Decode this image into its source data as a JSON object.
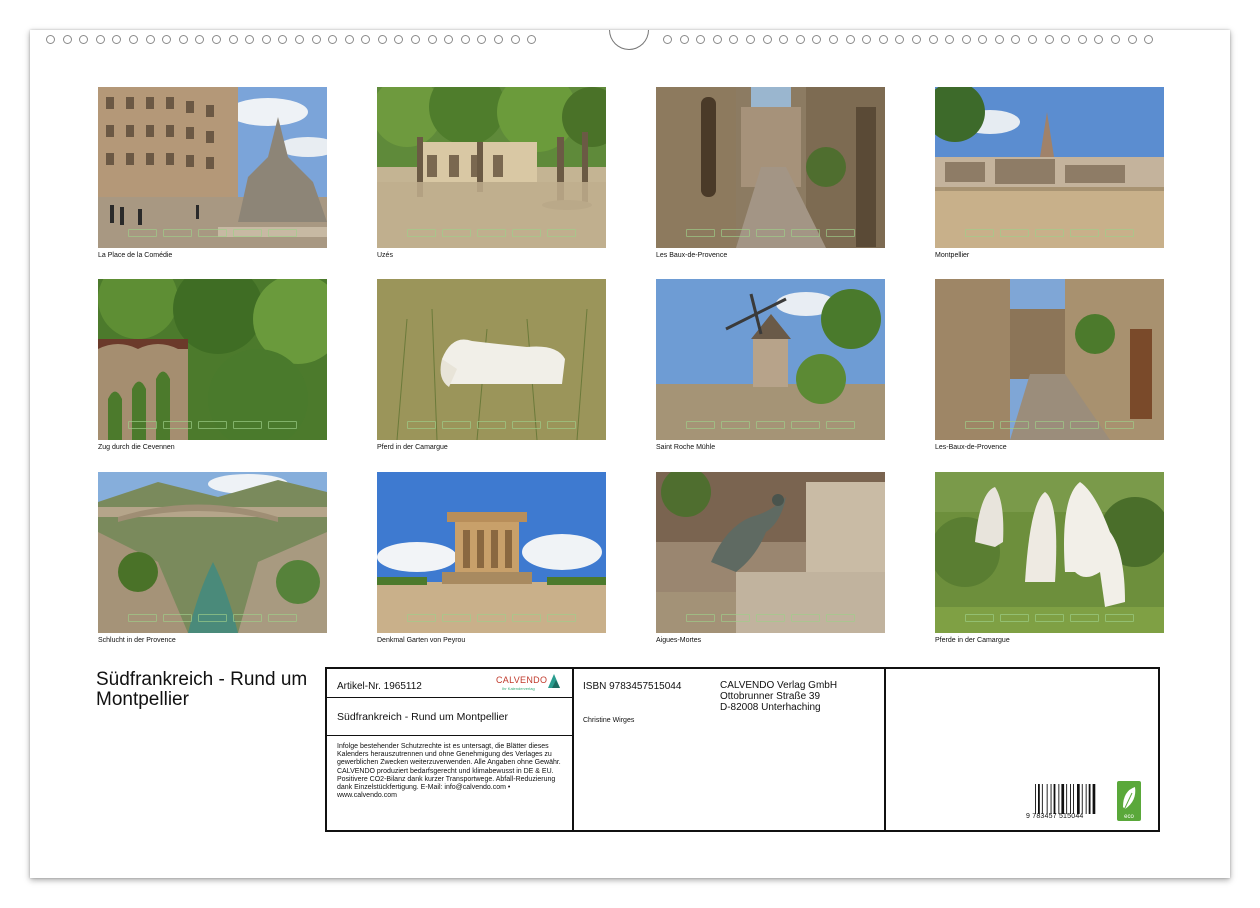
{
  "calendar": {
    "title": "Südfrankreich - Rund um Montpellier"
  },
  "photos": [
    {
      "caption": "La Place de la Comédie"
    },
    {
      "caption": "Uzés"
    },
    {
      "caption": "Les Baux-de-Provence"
    },
    {
      "caption": "Montpellier"
    },
    {
      "caption": "Zug durch die Cevennen"
    },
    {
      "caption": "Pferd in der Camargue"
    },
    {
      "caption": "Saint Roche Mühle"
    },
    {
      "caption": "Les-Baux-de-Provence"
    },
    {
      "caption": "Schlucht in der Provence"
    },
    {
      "caption": "Denkmal Garten von Peyrou"
    },
    {
      "caption": "Aigues-Mortes"
    },
    {
      "caption": "Pferde in der Camargue"
    }
  ],
  "info": {
    "article": "Artikel-Nr. 1965112",
    "logo_text": "CALVENDO",
    "logo_sub": "Ihr Kalenderverlag",
    "subtitle": "Südfrankreich - Rund um Montpellier",
    "legal": "Infolge bestehender Schutzrechte ist es untersagt, die Blätter dieses Kalenders herauszutrennen und ohne Genehmigung des Verlages zu gewerblichen Zwecken weiterzuverwenden. Alle Angaben ohne Gewähr. CALVENDO produziert bedarfsgerecht und klimabewusst in DE & EU. Positivere CO2-Bilanz dank kurzer Transportwege. Abfall-Reduzierung dank Einzelstückfertigung. E-Mail: info@calvendo.com • www.calvendo.com",
    "isbn": "ISBN 9783457515044",
    "author": "Christine Wirges",
    "publisher_line1": "CALVENDO Verlag GmbH",
    "publisher_line2": "Ottobrunner Straße 39",
    "publisher_line3": "D-82008 Unterhaching",
    "barcode_number": "9   783457   515044",
    "eco_label": "eco"
  }
}
